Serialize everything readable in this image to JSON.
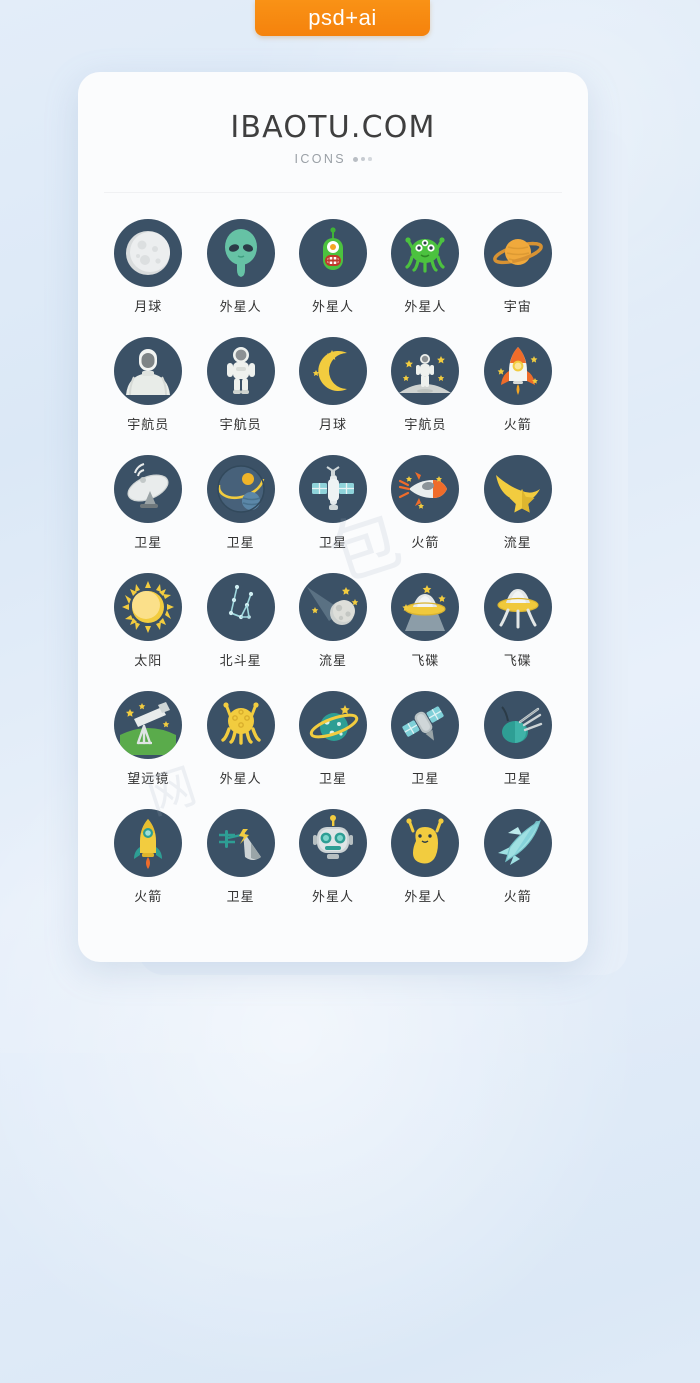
{
  "badge": {
    "label": "psd+ai"
  },
  "header": {
    "title": "IBAOTU.COM",
    "subtitle": "ICONS"
  },
  "icons": [
    {
      "label": "月球",
      "icon": "moon-full-icon"
    },
    {
      "label": "外星人",
      "icon": "alien-head-teal-icon"
    },
    {
      "label": "外星人",
      "icon": "alien-green-tall-icon"
    },
    {
      "label": "外星人",
      "icon": "alien-octopus-green-icon"
    },
    {
      "label": "宇宙",
      "icon": "saturn-planet-icon"
    },
    {
      "label": "宇航员",
      "icon": "astronaut-bust-icon"
    },
    {
      "label": "宇航员",
      "icon": "astronaut-full-icon"
    },
    {
      "label": "月球",
      "icon": "crescent-moon-stars-icon"
    },
    {
      "label": "宇航员",
      "icon": "astronaut-on-moon-icon"
    },
    {
      "label": "火箭",
      "icon": "rocket-orange-icon"
    },
    {
      "label": "卫星",
      "icon": "satellite-dish-icon"
    },
    {
      "label": "卫星",
      "icon": "orbit-planets-icon"
    },
    {
      "label": "卫星",
      "icon": "satellite-panels-icon"
    },
    {
      "label": "火箭",
      "icon": "rocket-horizontal-icon"
    },
    {
      "label": "流星",
      "icon": "shooting-star-icon"
    },
    {
      "label": "太阳",
      "icon": "sun-icon"
    },
    {
      "label": "北斗星",
      "icon": "big-dipper-icon"
    },
    {
      "label": "流星",
      "icon": "meteor-rock-icon"
    },
    {
      "label": "飞碟",
      "icon": "ufo-beam-icon"
    },
    {
      "label": "飞碟",
      "icon": "ufo-legs-icon"
    },
    {
      "label": "望远镜",
      "icon": "telescope-icon"
    },
    {
      "label": "外星人",
      "icon": "alien-yellow-octopus-icon"
    },
    {
      "label": "卫星",
      "icon": "ringed-planet-icon"
    },
    {
      "label": "卫星",
      "icon": "satellite-cross-icon"
    },
    {
      "label": "卫星",
      "icon": "satellite-antenna-icon"
    },
    {
      "label": "火箭",
      "icon": "rocket-yellow-icon"
    },
    {
      "label": "卫星",
      "icon": "satellite-signal-icon"
    },
    {
      "label": "外星人",
      "icon": "robot-head-icon"
    },
    {
      "label": "外星人",
      "icon": "alien-blob-yellow-icon"
    },
    {
      "label": "火箭",
      "icon": "space-shuttle-icon"
    }
  ],
  "colors": {
    "badge": "#f5820c",
    "circle": "#3b5166",
    "card": "#fbfcfd",
    "background": "#dfeaf7",
    "label": "#333333",
    "title": "#3f3f3f",
    "subtitle": "#9aa0a6"
  },
  "watermark": {
    "glyphs": [
      "包",
      "图",
      "网"
    ]
  }
}
